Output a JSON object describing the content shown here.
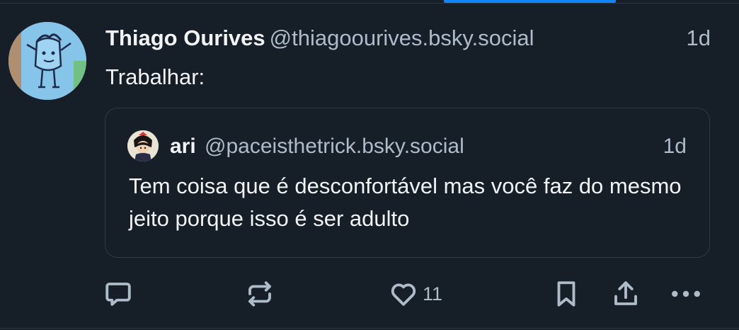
{
  "post": {
    "author": {
      "display_name": "Thiago Ourives",
      "handle": "@thiagoourives.bsky.social",
      "avatar_icon": "user-avatar"
    },
    "timestamp": "1d",
    "text": "Trabalhar:",
    "quote": {
      "author": {
        "display_name": "ari",
        "handle": "@paceisthetrick.bsky.social",
        "avatar_icon": "user-avatar"
      },
      "timestamp": "1d",
      "text": "Tem coisa que é desconfortável mas você faz do mesmo jeito porque isso é ser adulto"
    },
    "actions": {
      "reply_icon": "speech-bubble-icon",
      "repost_icon": "repost-arrows-icon",
      "like_icon": "heart-icon",
      "like_count": "11",
      "bookmark_icon": "bookmark-icon",
      "share_icon": "share-upload-icon",
      "more_icon": "more-dots-icon"
    }
  },
  "colors": {
    "background": "#161e27",
    "border": "#2e3a48",
    "primary_text": "#f1f3f5",
    "secondary_text": "#aebbc9",
    "accent": "#1083fe"
  }
}
